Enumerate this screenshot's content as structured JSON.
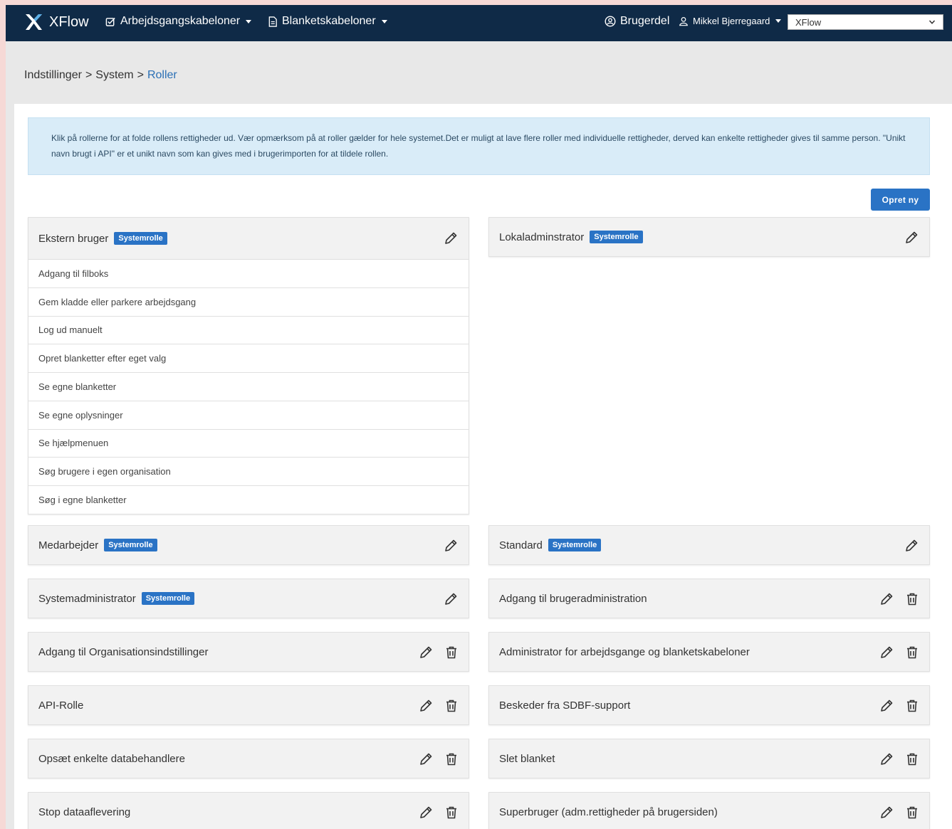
{
  "navbar": {
    "brand": "XFlow",
    "menu_workflow": "Arbejdsgangskabeloner",
    "menu_forms": "Blanketskabeloner",
    "user_part": "Brugerdel",
    "user_name": "Mikkel Bjerregaard",
    "org_select": "XFlow"
  },
  "breadcrumb": {
    "level1": "Indstillinger",
    "level2": "System",
    "current": "Roller",
    "separator": ">"
  },
  "info_text": "Klik på rollerne for at folde rollens rettigheder ud. Vær opmærksom på at roller gælder for hele systemet.Det er muligt at lave flere roller med individuelle rettigheder, derved kan enkelte rettigheder gives til samme person. \"Unikt navn brugt i API\" er et unikt navn som kan gives med i brugerimporten for at tildele rollen.",
  "create_button": "Opret ny",
  "badge_label": "Systemrolle",
  "roles": {
    "ekstern": "Ekstern bruger",
    "lokaladmin": "Lokaladminstrator",
    "medarbejder": "Medarbejder",
    "standard": "Standard",
    "sysadmin": "Systemadministrator",
    "brugeradm": "Adgang til brugeradministration",
    "orgindst": "Adgang til Organisationsindstillinger",
    "adm_arb": "Administrator for arbejdsgange og blanketskabeloner",
    "api": "API-Rolle",
    "sdbf": "Beskeder fra SDBF-support",
    "databeh": "Opsæt enkelte databehandlere",
    "slet": "Slet blanket",
    "stopdata": "Stop dataaflevering",
    "superbruger": "Superbruger (adm.rettigheder på brugersiden)"
  },
  "permissions": [
    "Adgang til filboks",
    "Gem kladde eller parkere arbejdsgang",
    "Log ud manuelt",
    "Opret blanketter efter eget valg",
    "Se egne blanketter",
    "Se egne oplysninger",
    "Se hjælpmenuen",
    "Søg brugere i egen organisation",
    "Søg i egne blanketter"
  ],
  "colors": {
    "navbar": "#0f2a47",
    "accent": "#2a73c5",
    "info_bg": "#d9ecf8"
  }
}
